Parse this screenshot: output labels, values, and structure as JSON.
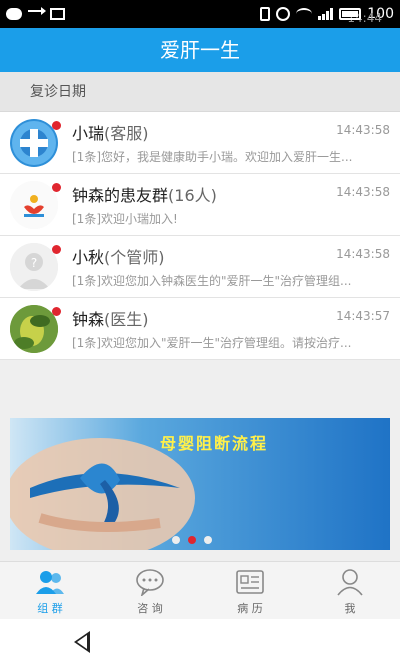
{
  "status_bar": {
    "time": "14:44",
    "battery_level": "100"
  },
  "app": {
    "title": "爱肝一生"
  },
  "section": {
    "label": "复诊日期"
  },
  "chats": [
    {
      "name": "小瑞",
      "role": "(客服)",
      "time": "14:43:58",
      "preview": "[1条]您好，我是健康助手小瑞。欢迎加入爱肝一生..."
    },
    {
      "name": "钟森的患友群",
      "role": "(16人)",
      "time": "14:43:58",
      "preview": "[1条]欢迎小瑞加入!"
    },
    {
      "name": "小秋",
      "role": "(个管师)",
      "time": "14:43:58",
      "preview": "[1条]欢迎您加入钟森医生的\"爱肝一生\"治疗管理组..."
    },
    {
      "name": "钟森",
      "role": "(医生)",
      "time": "14:43:57",
      "preview": "[1条]欢迎您加入\"爱肝一生\"治疗管理组。请按治疗..."
    }
  ],
  "banner": {
    "title": "母婴阻断流程"
  },
  "bottom_nav": [
    {
      "label": "组 群",
      "icon": "group-icon",
      "active": true
    },
    {
      "label": "咨 询",
      "icon": "chat-bubble-icon",
      "active": false
    },
    {
      "label": "病 历",
      "icon": "medical-record-icon",
      "active": false
    },
    {
      "label": "我",
      "icon": "profile-icon",
      "active": false
    }
  ],
  "colors": {
    "accent": "#1b9ee9",
    "badge": "#e0262f"
  }
}
